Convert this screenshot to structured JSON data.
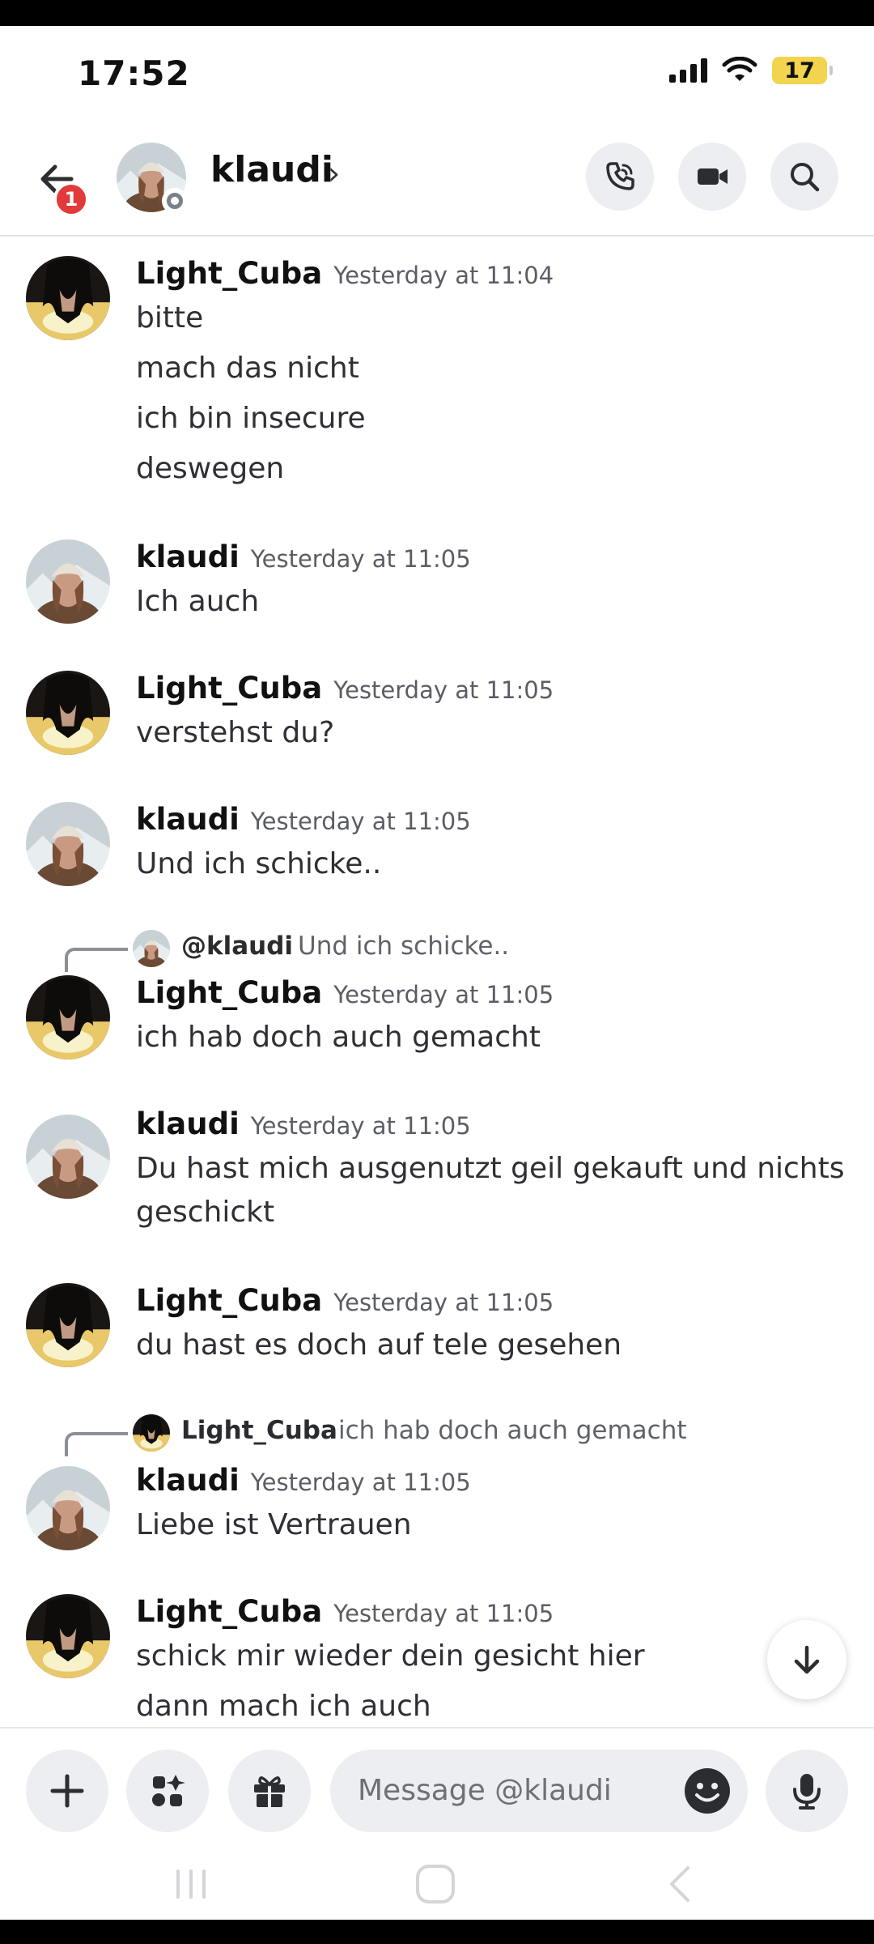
{
  "status_bar": {
    "time": "17:52",
    "battery": "17"
  },
  "header": {
    "back_badge": "1",
    "contact_name": "klaudi",
    "chevron": "›",
    "icons": [
      "back-arrow-icon",
      "voice-call-icon",
      "video-call-icon",
      "search-icon"
    ]
  },
  "messages": [
    {
      "author": "Light_Cuba",
      "time": "Yesterday at 11:04",
      "lines": [
        "bitte",
        "mach das nicht",
        "ich bin insecure",
        "deswegen"
      ]
    },
    {
      "author": "klaudi",
      "time": "Yesterday at 11:05",
      "lines": [
        "Ich auch"
      ]
    },
    {
      "author": "Light_Cuba",
      "time": "Yesterday at 11:05",
      "lines": [
        "verstehst du?"
      ]
    },
    {
      "author": "klaudi",
      "time": "Yesterday at 11:05",
      "lines": [
        "Und ich schicke.."
      ]
    },
    {
      "reply_to": {
        "author": "@klaudi",
        "text": "Und ich schicke.."
      },
      "author": "Light_Cuba",
      "time": "Yesterday at 11:05",
      "lines": [
        "ich hab doch auch gemacht"
      ]
    },
    {
      "author": "klaudi",
      "time": "Yesterday at 11:05",
      "lines": [
        "Du hast mich ausgenutzt geil gekauft und nichts",
        "geschickt"
      ]
    },
    {
      "author": "Light_Cuba",
      "time": "Yesterday at 11:05",
      "lines": [
        "du hast es doch auf tele gesehen"
      ]
    },
    {
      "reply_to": {
        "author": "Light_Cuba",
        "text": "ich hab doch auch gemacht"
      },
      "author": "klaudi",
      "time": "Yesterday at 11:05",
      "lines": [
        "Liebe ist Vertrauen"
      ]
    },
    {
      "author": "Light_Cuba",
      "time": "Yesterday at 11:05",
      "lines": [
        "schick mir wieder dein gesicht hier",
        "dann mach ich auch"
      ]
    }
  ],
  "composer": {
    "placeholder": "Message @klaudi",
    "icons": [
      "plus-icon",
      "apps-icon",
      "gift-icon",
      "emoji-icon",
      "microphone-icon"
    ]
  },
  "colors": {
    "accent_badge": "#e23a3a",
    "battery": "#f3d44e",
    "status_offline": "#7c8089"
  }
}
